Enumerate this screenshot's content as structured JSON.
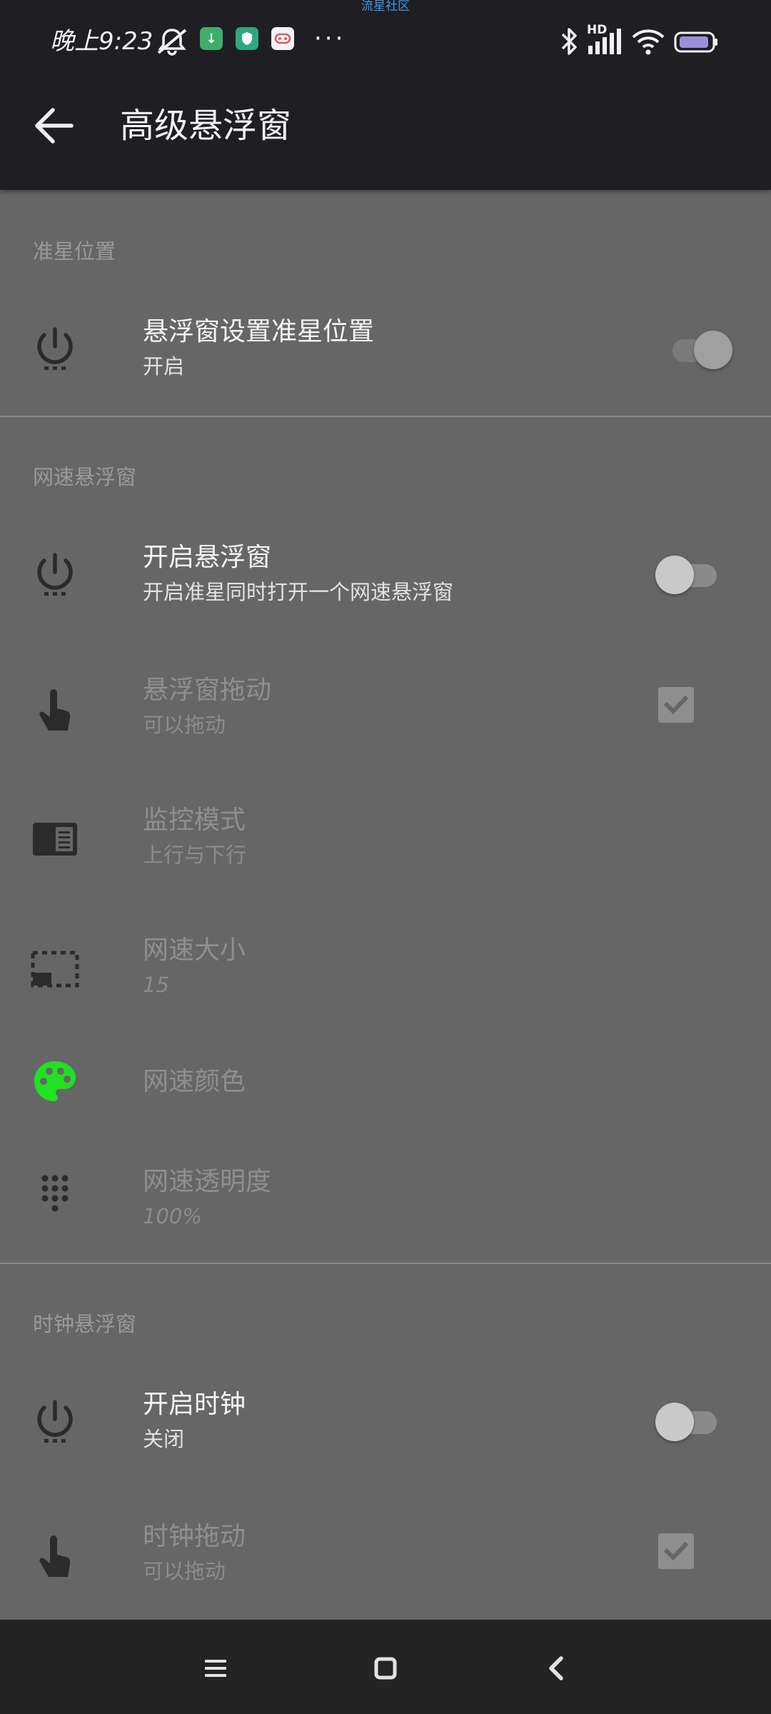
{
  "status_bar": {
    "watermark": "流星社区",
    "time": "晚上9:23",
    "more_indicator": "···",
    "signal_label": "HD"
  },
  "toolbar": {
    "back_icon": "arrow-left-icon",
    "title": "高级悬浮窗"
  },
  "sections": {
    "crosshair": {
      "header": "准星位置",
      "items": [
        {
          "title": "悬浮窗设置准星位置",
          "subtitle": "开启",
          "icon": "power-icon",
          "control": "switch",
          "checked": true,
          "enabled": true
        }
      ]
    },
    "netspeed": {
      "header": "网速悬浮窗",
      "items": [
        {
          "title": "开启悬浮窗",
          "subtitle": "开启准星同时打开一个网速悬浮窗",
          "icon": "power-icon",
          "control": "switch",
          "checked": false,
          "enabled": true
        },
        {
          "title": "悬浮窗拖动",
          "subtitle": "可以拖动",
          "icon": "touch-icon",
          "control": "checkbox",
          "checked": true,
          "enabled": false
        },
        {
          "title": "监控模式",
          "subtitle": "上行与下行",
          "icon": "reader-mode-icon",
          "control": "none",
          "enabled": false
        },
        {
          "title": "网速大小",
          "subtitle": "15",
          "icon": "picture-in-picture-icon",
          "control": "none",
          "enabled": false
        },
        {
          "title": "网速颜色",
          "icon": "palette-icon",
          "control": "none",
          "enabled": false
        },
        {
          "title": "网速透明度",
          "subtitle": "100%",
          "icon": "dialpad-icon",
          "control": "none",
          "enabled": false
        }
      ]
    },
    "clock": {
      "header": "时钟悬浮窗",
      "items": [
        {
          "title": "开启时钟",
          "subtitle": "关闭",
          "icon": "power-icon",
          "control": "switch",
          "checked": false,
          "enabled": true
        },
        {
          "title": "时钟拖动",
          "subtitle": "可以拖动",
          "icon": "touch-icon",
          "control": "checkbox",
          "checked": true,
          "enabled": false
        }
      ]
    }
  },
  "colors": {
    "toolbar_bg": "#1f1e23",
    "content_bg": "#666666",
    "palette_icon": "#22e022",
    "switch_on_thumb": "#a0a0a0",
    "switch_off_thumb": "#c9c9c9"
  },
  "navigation_bar": {
    "menu_icon": "menu-icon",
    "home_icon": "home-icon",
    "back_icon": "back-chevron-icon"
  }
}
